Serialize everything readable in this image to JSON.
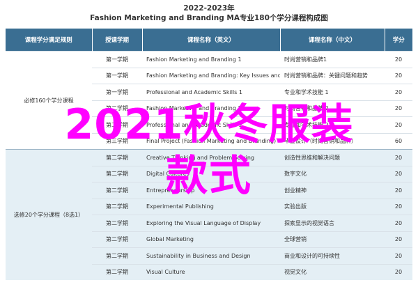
{
  "header": {
    "year": "2022-2023年",
    "title": "Fashion Marketing and Branding MA专业180个学分课程构成图"
  },
  "table": {
    "columns": [
      "课程学分满足规则",
      "授课学期",
      "课程名称（英文）",
      "课程名称（中文）",
      "学分"
    ],
    "groups": [
      {
        "rule": "必修160个学分课程",
        "rows": [
          {
            "term": "第一学期",
            "en": "Fashion Marketing and Branding 1",
            "cn": "时尚营销和品牌1",
            "credits": "20"
          },
          {
            "term": "第一学期",
            "en": "Fashion Marketing and Branding: Key Issues and Trends",
            "cn": "时尚营销和品牌：关键问题和趋势",
            "credits": "20"
          },
          {
            "term": "第一学期",
            "en": "Professional and Academic Skills 1",
            "cn": "专业和学术技能 1",
            "credits": "20"
          },
          {
            "term": "第二学期",
            "en": "Fashion Marketing and Branding 2",
            "cn": "时尚营销和品牌 2",
            "credits": "20"
          },
          {
            "term": "第二学期",
            "en": "Professional and Academic Skills 2",
            "cn": "专业和学术技能 2",
            "credits": "20"
          },
          {
            "term": "第三学期",
            "en": "Final Project (Fashion Marketing and Branding)",
            "cn": "毕业设计（时尚营销和品牌）",
            "credits": "60"
          }
        ]
      },
      {
        "rule": "选修20个学分课程（8选1）",
        "rows": [
          {
            "term": "第二学期",
            "en": "Creative Thinking and Problem Solving",
            "cn": "创造性思维和解决问题",
            "credits": "20"
          },
          {
            "term": "第二学期",
            "en": "Digital Cultures",
            "cn": "数字文化",
            "credits": "20"
          },
          {
            "term": "第二学期",
            "en": "Entrepreneurship",
            "cn": "创业精神",
            "credits": "20"
          },
          {
            "term": "第二学期",
            "en": "Experimental Publishing",
            "cn": "实验出版",
            "credits": "20"
          },
          {
            "term": "第二学期",
            "en": "Exploring the Visual Language of Display",
            "cn": "探索显示的视觉语言",
            "credits": "20"
          },
          {
            "term": "第二学期",
            "en": "Global Marketing",
            "cn": "全球营销",
            "credits": "20"
          },
          {
            "term": "第二学期",
            "en": "Sustainability in Business and Design",
            "cn": "商业和设计的可持续性",
            "credits": "20"
          },
          {
            "term": "第二学期",
            "en": "Visual Culture",
            "cn": "视觉文化",
            "credits": "20"
          }
        ]
      }
    ]
  },
  "overlay": {
    "line1": "2021秋冬服装",
    "line2": "款式",
    "color": "#ff00ff"
  },
  "colors": {
    "header_bg": "#3a6e92",
    "elective_bg": "#e4eff5"
  }
}
